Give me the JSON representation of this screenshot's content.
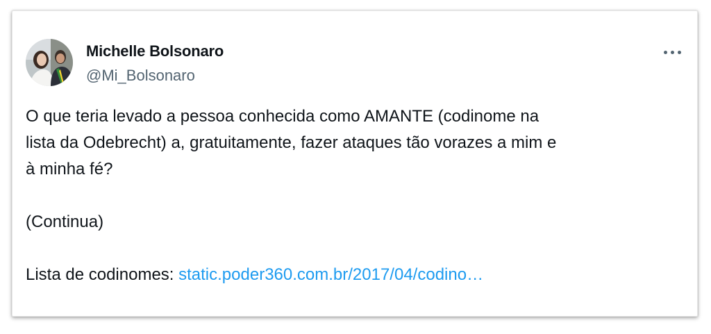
{
  "tweet": {
    "author_name": "Michelle Bolsonaro",
    "author_handle": "@Mi_Bolsonaro",
    "text_lines": [
      "O que teria levado a pessoa conhecida como AMANTE (codinome na",
      "lista da Odebrecht) a, gratuitamente, fazer ataques tão vorazes a mim e",
      "à minha fé?"
    ],
    "continuation": "(Continua)",
    "list_label": "Lista de codinomes: ",
    "link_text": "static.poder360.com.br/2017/04/codino…",
    "more_icon": "more-horizontal-icon",
    "avatar_icon": "profile-photo",
    "colors": {
      "text": "#0f1419",
      "secondary": "#536471",
      "link": "#1d9bf0"
    }
  }
}
